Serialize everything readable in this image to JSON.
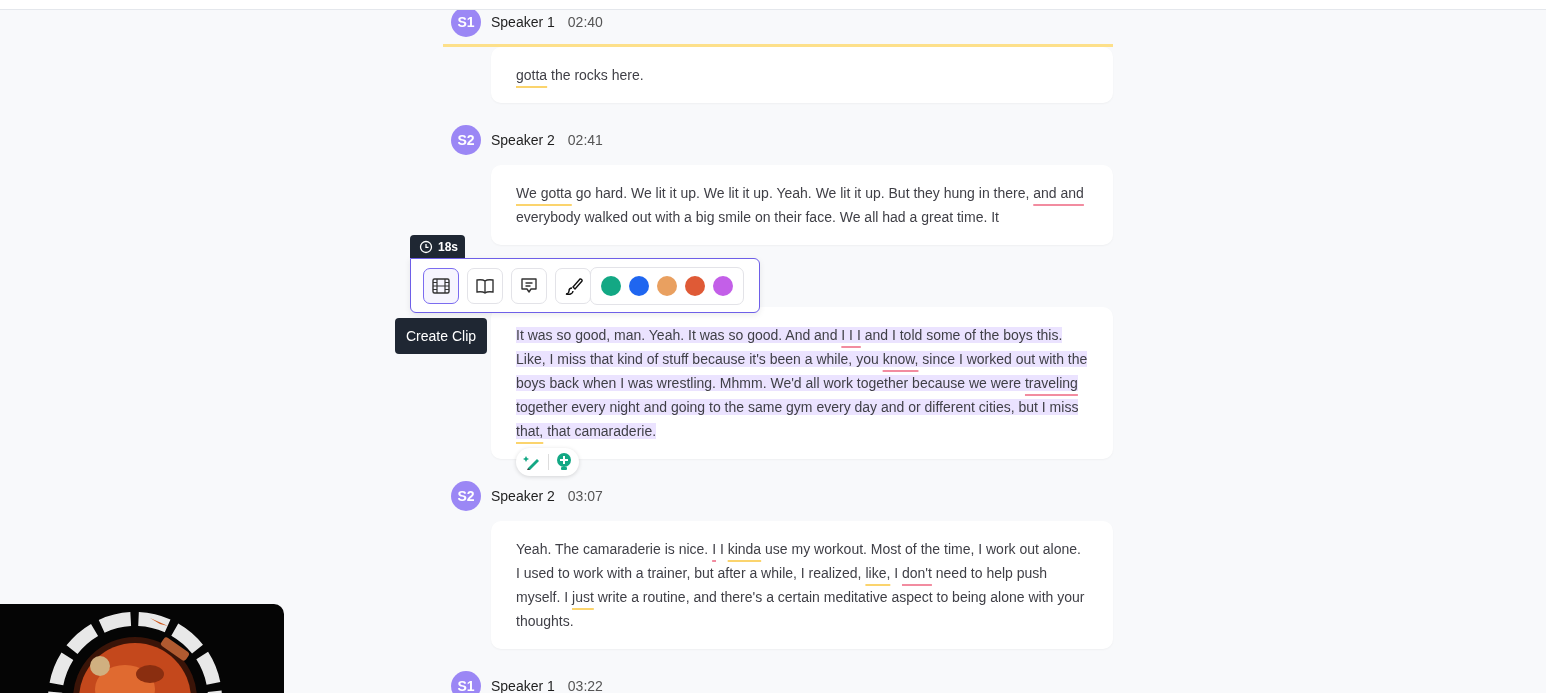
{
  "segments": [
    {
      "avatar": "S1",
      "speaker": "Speaker 1",
      "time": "02:40",
      "active": true,
      "selected": false,
      "runs": [
        {
          "text": "gotta",
          "kind": "filler"
        },
        {
          "text": " the rocks here."
        }
      ]
    },
    {
      "avatar": "S2",
      "speaker": "Speaker 2",
      "time": "02:41",
      "active": false,
      "selected": false,
      "runs": [
        {
          "text": "We gotta",
          "kind": "filler"
        },
        {
          "text": " go hard. We lit it up. We lit it up. Yeah. We lit it up. But they hung in there, "
        },
        {
          "text": "and and",
          "kind": "repeat"
        },
        {
          "text": " everybody walked out with a big smile on their face. We all had a great time. It"
        }
      ]
    },
    {
      "active": false,
      "selected": true,
      "runs": [
        {
          "text": "It was so good, man. Yeah. It was so good. And and "
        },
        {
          "text": "I I I",
          "kind": "repeat"
        },
        {
          "text": " and I told some of the boys this. Like, I miss that kind of stuff because it's been a while, you "
        },
        {
          "text": "know,",
          "kind": "repeat"
        },
        {
          "text": " since I worked out with the boys back when I was wrestling. Mhmm. We'd all work together because we were "
        },
        {
          "text": "traveling",
          "kind": "repeat"
        },
        {
          "text": " together every night and going to the same gym every day and or different cities, but I miss "
        },
        {
          "text": "that,",
          "kind": "filler"
        },
        {
          "text": " that camaraderie."
        }
      ]
    },
    {
      "avatar": "S2",
      "speaker": "Speaker 2",
      "time": "03:07",
      "active": false,
      "selected": false,
      "runs": [
        {
          "text": "Yeah. The camaraderie is nice. "
        },
        {
          "text": "I",
          "kind": "repeat"
        },
        {
          "text": " I "
        },
        {
          "text": "kinda",
          "kind": "filler"
        },
        {
          "text": " use my workout. Most of the time, I work out alone. I used to work with a trainer, but after a while, I realized, "
        },
        {
          "text": "like,",
          "kind": "filler"
        },
        {
          "text": " I "
        },
        {
          "text": "don't",
          "kind": "repeat"
        },
        {
          "text": " need to help push myself. I "
        },
        {
          "text": "just",
          "kind": "filler"
        },
        {
          "text": " write a routine, and there's a certain meditative aspect to being alone with your thoughts."
        }
      ]
    },
    {
      "avatar": "S1",
      "speaker": "Speaker 1",
      "time": "03:22",
      "active": false,
      "selected": false
    }
  ],
  "toolbar": {
    "duration": "18s",
    "tooltip": "Create Clip",
    "tools": [
      {
        "kind": "clip",
        "selected": true
      },
      {
        "kind": "book",
        "selected": false
      },
      {
        "kind": "comment",
        "selected": false
      },
      {
        "kind": "brush",
        "selected": false
      }
    ],
    "colors": [
      {
        "color": "#13a884"
      },
      {
        "color": "#1f66f0"
      },
      {
        "color": "#e9a060"
      },
      {
        "color": "#df5a36"
      },
      {
        "color": "#c35fe8"
      }
    ]
  }
}
